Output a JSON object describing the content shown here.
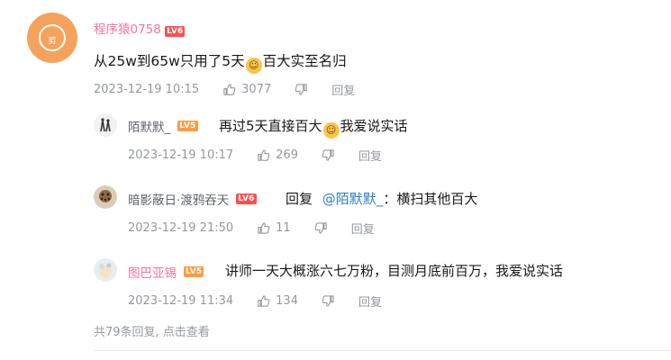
{
  "main_comment": {
    "avatar_char": "剪",
    "username": "程序猿0758",
    "level": "LV6",
    "text_before": "从25w到65w只用了5天",
    "emoji": "cat-face-emoji",
    "text_after": "百大实至名归",
    "time": "2023-12-19 10:15",
    "likes": "3077",
    "reply_label": "回复"
  },
  "replies": [
    {
      "username": "陌默默_",
      "level": "LV5",
      "text_before": "再过5天直接百大",
      "emoji": "cat-face-emoji",
      "text_after": "我爱说实话",
      "time": "2023-12-19 10:17",
      "likes": "269",
      "reply_label": "回复"
    },
    {
      "username": "暗影蔽日·渡鸦吞天",
      "level": "LV6",
      "prefix": "回复",
      "mention": "@陌默默_",
      "text": "：横扫其他百大",
      "time": "2023-12-19 21:50",
      "likes": "11",
      "reply_label": "回复"
    },
    {
      "username": "图巴亚锡",
      "level": "LV5",
      "text": "讲师一天大概涨六七万粉，目测月底前百万，我爱说实话",
      "time": "2023-12-19 11:34",
      "likes": "134",
      "reply_label": "回复"
    }
  ],
  "footer": {
    "text": "共79条回复, 点击查看"
  },
  "colors": {
    "vip_name": "#fb7299",
    "normal_name": "#61666d",
    "meta": "#9499a0",
    "lv6": "#ff4e4e",
    "lv5": "#ff9b3f",
    "mention": "#2d7fbf"
  }
}
